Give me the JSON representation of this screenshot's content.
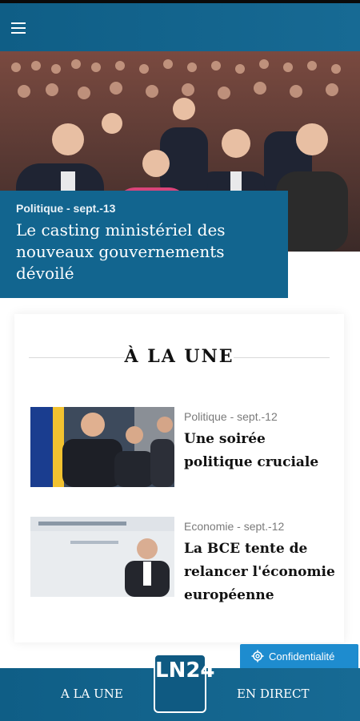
{
  "header": {
    "menu_icon": "hamburger-menu-icon"
  },
  "hero": {
    "category_date": "Politique - sept.-13",
    "title": "Le casting ministériel des nouveaux gouvernements dévoilé"
  },
  "section": {
    "title": "À LA UNE",
    "articles": [
      {
        "category_date": "Politique - sept.-12",
        "title": "Une soirée politique cruciale"
      },
      {
        "category_date": "Economie - sept.-12",
        "title": "La BCE tente de relancer l'économie européenne"
      }
    ]
  },
  "privacy": {
    "label": "Confidentialité",
    "icon": "gear-icon"
  },
  "bottom_nav": {
    "left_label": "A LA UNE",
    "right_label": "EN DIRECT",
    "logo_text": "LN24"
  },
  "colors": {
    "brand": "#12658f",
    "accent": "#1e8ccf"
  }
}
